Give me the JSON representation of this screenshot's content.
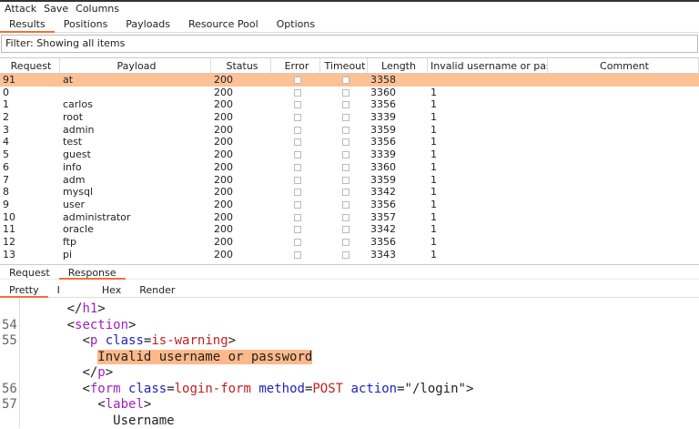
{
  "menu": [
    "Attack",
    "Save",
    "Columns"
  ],
  "tabs": [
    {
      "label": "Results",
      "active": true
    },
    {
      "label": "Positions"
    },
    {
      "label": "Payloads"
    },
    {
      "label": "Resource Pool"
    },
    {
      "label": "Options"
    }
  ],
  "filter": "Filter: Showing all items",
  "table": {
    "columns": [
      "Request",
      "Payload",
      "Status",
      "Error",
      "Timeout",
      "Length",
      "Invalid username or pas...",
      "Comment"
    ],
    "sort_icon": "chevron-up-icon",
    "rows": [
      [
        "91",
        "at",
        "200",
        "",
        "",
        "3358",
        "",
        ""
      ],
      [
        "0",
        "",
        "200",
        "",
        "",
        "3360",
        "1",
        ""
      ],
      [
        "1",
        "carlos",
        "200",
        "",
        "",
        "3356",
        "1",
        ""
      ],
      [
        "2",
        "root",
        "200",
        "",
        "",
        "3339",
        "1",
        ""
      ],
      [
        "3",
        "admin",
        "200",
        "",
        "",
        "3359",
        "1",
        ""
      ],
      [
        "4",
        "test",
        "200",
        "",
        "",
        "3356",
        "1",
        ""
      ],
      [
        "5",
        "guest",
        "200",
        "",
        "",
        "3339",
        "1",
        ""
      ],
      [
        "6",
        "info",
        "200",
        "",
        "",
        "3360",
        "1",
        ""
      ],
      [
        "7",
        "adm",
        "200",
        "",
        "",
        "3359",
        "1",
        ""
      ],
      [
        "8",
        "mysql",
        "200",
        "",
        "",
        "3342",
        "1",
        ""
      ],
      [
        "9",
        "user",
        "200",
        "",
        "",
        "3356",
        "1",
        ""
      ],
      [
        "10",
        "administrator",
        "200",
        "",
        "",
        "3357",
        "1",
        ""
      ],
      [
        "11",
        "oracle",
        "200",
        "",
        "",
        "3342",
        "1",
        ""
      ],
      [
        "12",
        "ftp",
        "200",
        "",
        "",
        "3356",
        "1",
        ""
      ],
      [
        "13",
        "pi",
        "200",
        "",
        "",
        "3343",
        "1",
        ""
      ]
    ],
    "selected_row": 0,
    "selected_color": "#fdc196"
  },
  "bottom_tabs": [
    {
      "label": "Request"
    },
    {
      "label": "Response",
      "active": true
    }
  ],
  "view_tabs": [
    {
      "label": "Pretty",
      "active": true
    },
    {
      "label": "I"
    },
    {
      "label": "Hex"
    },
    {
      "label": "Render"
    }
  ],
  "code": {
    "lines": [
      {
        "num": "",
        "indent": 6,
        "parts": [
          [
            "tg",
            "</"
          ],
          [
            "nm",
            "h1"
          ],
          [
            "tg",
            ">"
          ]
        ]
      },
      {
        "num": "54",
        "indent": 6,
        "parts": [
          [
            "tg",
            "<"
          ],
          [
            "nm",
            "section"
          ],
          [
            "tg",
            ">"
          ]
        ]
      },
      {
        "num": "55",
        "indent": 8,
        "parts": [
          [
            "tg",
            "<"
          ],
          [
            "nm",
            "p"
          ],
          [
            "tg",
            " "
          ],
          [
            "at",
            "class"
          ],
          [
            "tg",
            "="
          ],
          [
            "vl",
            "is-warning"
          ],
          [
            "tg",
            ">"
          ]
        ]
      },
      {
        "num": "",
        "indent": 10,
        "parts": [
          [
            "hl",
            "Invalid username or password"
          ]
        ]
      },
      {
        "num": "",
        "indent": 8,
        "parts": [
          [
            "tg",
            "</"
          ],
          [
            "nm",
            "p"
          ],
          [
            "tg",
            ">"
          ]
        ]
      },
      {
        "num": "56",
        "indent": 8,
        "parts": [
          [
            "tg",
            "<"
          ],
          [
            "nm",
            "form"
          ],
          [
            "tg",
            " "
          ],
          [
            "at",
            "class"
          ],
          [
            "tg",
            "="
          ],
          [
            "vl",
            "login-form"
          ],
          [
            "tg",
            " "
          ],
          [
            "at",
            "method"
          ],
          [
            "tg",
            "="
          ],
          [
            "vl",
            "POST"
          ],
          [
            "tg",
            " "
          ],
          [
            "at",
            "action"
          ],
          [
            "tg",
            "=\"/login\">"
          ]
        ]
      },
      {
        "num": "57",
        "indent": 10,
        "parts": [
          [
            "tg",
            "<"
          ],
          [
            "nm",
            "label"
          ],
          [
            "tg",
            ">"
          ]
        ]
      },
      {
        "num": "",
        "indent": 12,
        "parts": [
          [
            "tg",
            "Username"
          ]
        ]
      }
    ],
    "highlight_color": "#fdb98a"
  }
}
